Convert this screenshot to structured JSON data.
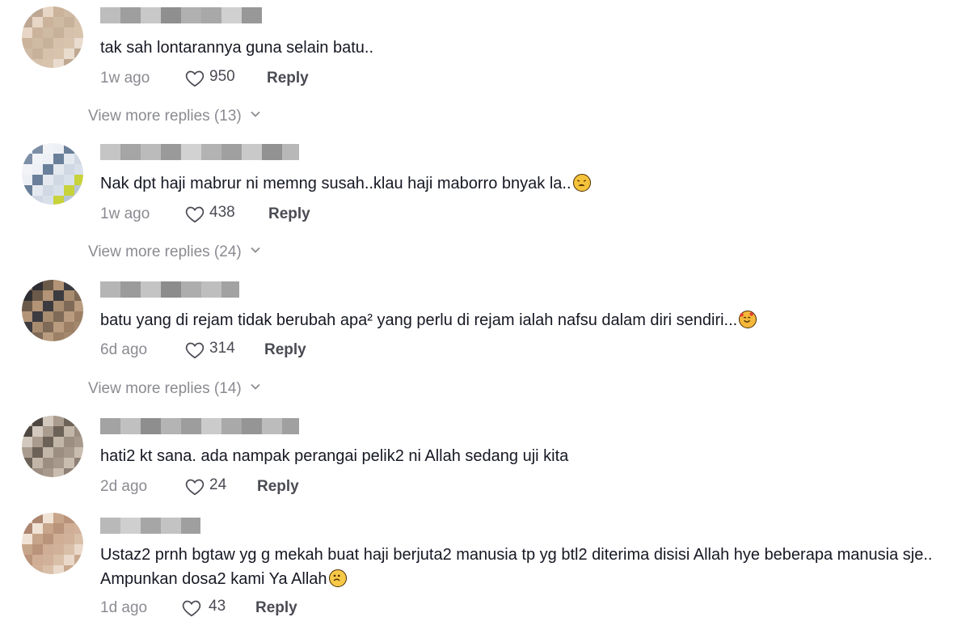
{
  "comments": [
    {
      "text": "tak sah lontarannya guna selain batu..",
      "time": "1w ago",
      "likes": "950",
      "reply_label": "Reply",
      "view_more": "View more replies (13)",
      "emoji": null
    },
    {
      "text": "Nak dpt haji mabrur ni memng susah..klau haji maborro bnyak la..",
      "time": "1w ago",
      "likes": "438",
      "reply_label": "Reply",
      "view_more": "View more replies (24)",
      "emoji": "weary-face-emoji"
    },
    {
      "text": "batu yang di rejam tidak berubah apa² yang perlu di rejam ialah nafsu dalam diri sendiri...",
      "time": "6d ago",
      "likes": "314",
      "reply_label": "Reply",
      "view_more": "View more replies (14)",
      "emoji": "smiling-face-with-hearts-emoji"
    },
    {
      "text": "hati2 kt sana. ada nampak perangai pelik2 ni Allah sedang uji kita",
      "time": "2d ago",
      "likes": "24",
      "reply_label": "Reply",
      "view_more": null,
      "emoji": null
    },
    {
      "text": "Ustaz2 prnh bgtaw yg g mekah buat haji berjuta2 manusia tp yg btl2 diterima disisi Allah hye beberapa manusia sje.. Ampunkan dosa2 kami Ya Allah",
      "time": "1d ago",
      "likes": "43",
      "reply_label": "Reply",
      "view_more": null,
      "emoji": "slightly-frowning-face-emoji"
    }
  ],
  "icons": {
    "like": "heart-outline-icon",
    "expand": "chevron-down-icon"
  },
  "colors": {
    "text_primary": "#161823",
    "text_secondary": "#8a8b91",
    "action": "#4a4b53"
  }
}
